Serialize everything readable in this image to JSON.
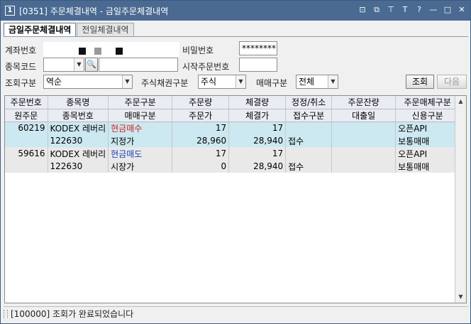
{
  "window": {
    "number": "1",
    "title": "[0351] 주문체결내역 - 금일주문체결내역",
    "icons": [
      "restore-icon",
      "copy-icon",
      "pin-icon",
      "font-icon",
      "help-icon",
      "minimize-icon",
      "maximize-icon",
      "close-icon"
    ],
    "icon_glyphs": [
      "⊡",
      "⧉",
      "⊤",
      "T",
      "?",
      "—",
      "□",
      "✕"
    ]
  },
  "tabs": [
    {
      "label": "금일주문체결내역",
      "active": true
    },
    {
      "label": "전일체결내역",
      "active": false
    }
  ],
  "form": {
    "account_label": "계좌번호",
    "password_label": "비밀번호",
    "password_value": "********",
    "code_label": "종목코드",
    "code_value": "",
    "stock_name_value": "",
    "start_order_label": "시작주문번호",
    "start_order_value": "",
    "query_type_label": "조회구분",
    "query_type_value": "역순",
    "security_type_label": "주식채권구분",
    "security_type_value": "주식",
    "trade_type_label": "매매구분",
    "trade_type_value": "전체",
    "search_button": "조회",
    "next_button": "다음"
  },
  "grid": {
    "headers_top": [
      "주문번호",
      "종목명",
      "주문구분",
      "주문량",
      "체결량",
      "정정/취소",
      "주문잔량",
      "주문매체구분"
    ],
    "headers_bottom": [
      "원주문",
      "종목번호",
      "매매구분",
      "주문가",
      "체결가",
      "접수구분",
      "대출일",
      "신용구분"
    ],
    "rows": [
      {
        "order_no": "60219",
        "name": "KODEX 레버리",
        "order_type": "현금매수",
        "qty": "17",
        "filled_qty": "17",
        "modify": "",
        "remain": "",
        "media": "오픈API",
        "orig": "",
        "code": "122630",
        "trade_type": "지정가",
        "price": "28,960",
        "filled_price": "28,940",
        "accept": "접수",
        "loan_date": "",
        "credit": "보통매매"
      },
      {
        "order_no": "59616",
        "name": "KODEX 레버리",
        "order_type": "현금매도",
        "qty": "17",
        "filled_qty": "17",
        "modify": "",
        "remain": "",
        "media": "오픈API",
        "orig": "",
        "code": "122630",
        "trade_type": "시장가",
        "price": "0",
        "filled_price": "28,940",
        "accept": "접수",
        "loan_date": "",
        "credit": "보통매매"
      }
    ]
  },
  "status": {
    "message": "[100000] 조회가 완료되었습니다"
  },
  "colors": {
    "titlebar": "#4a6a92",
    "buy": "#d21f1f",
    "sell": "#1d3fb5",
    "row_selected": "#cce8f0"
  }
}
